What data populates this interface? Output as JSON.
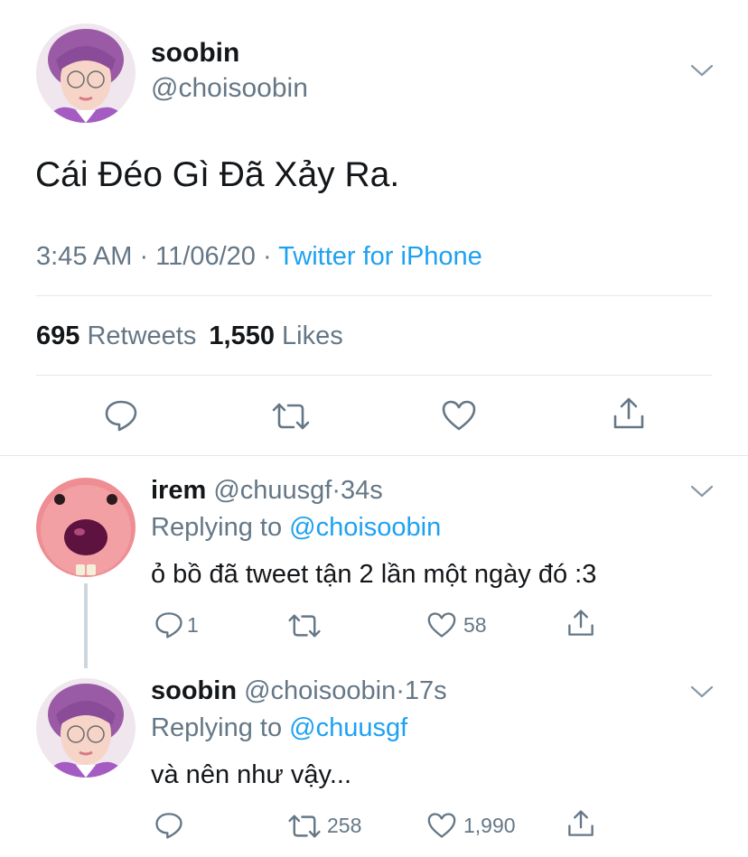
{
  "main_tweet": {
    "display_name": "soobin",
    "handle": "@choisoobin",
    "text": "Cái Đéo Gì Đã Xảy Ra.",
    "time": "3:45 AM · 11/06/20 · ",
    "source": "Twitter for iPhone",
    "retweet_count": "695",
    "retweet_label": "Retweets",
    "like_count": "1,550",
    "like_label": "Likes"
  },
  "replies": [
    {
      "display_name": "irem",
      "handle": "@chuusgf",
      "separator": "·",
      "age": "34s",
      "replying_prefix": "Replying to",
      "replying_to": "@choisoobin",
      "text": "ỏ bồ đã tweet tận 2 lần một ngày đó :3",
      "reply_count": "1",
      "retweet_count": "",
      "like_count": "58"
    },
    {
      "display_name": "soobin",
      "handle": "@choisoobin",
      "separator": "·",
      "age": "17s",
      "replying_prefix": "Replying to",
      "replying_to": "@chuusgf",
      "text": "và nên như vậy...",
      "reply_count": "",
      "retweet_count": "258",
      "like_count": "1,990"
    }
  ],
  "colors": {
    "link": "#1da1f2",
    "muted": "#657786",
    "text": "#14171a",
    "divider": "#e1e8ed",
    "icon": "#657786"
  }
}
